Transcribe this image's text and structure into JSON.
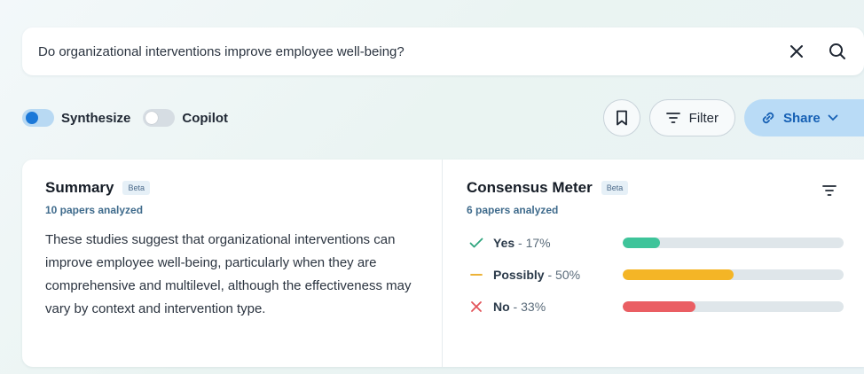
{
  "search": {
    "query": "Do organizational interventions improve employee well-being?",
    "clear_icon": "close-icon",
    "search_icon": "search-icon"
  },
  "controls": {
    "synthesize_label": "Synthesize",
    "synthesize_on": true,
    "copilot_label": "Copilot",
    "copilot_on": false,
    "filter_label": "Filter",
    "share_label": "Share"
  },
  "summary": {
    "title": "Summary",
    "badge": "Beta",
    "papers": "10 papers analyzed",
    "text": "These studies suggest that organizational interventions can improve employee well-being, particularly when they are comprehensive and multilevel, although the effectiveness may vary by context and intervention type."
  },
  "consensus": {
    "title": "Consensus Meter",
    "badge": "Beta",
    "papers": "6 papers analyzed",
    "rows": [
      {
        "label": "Yes",
        "pct_text": "17%",
        "value": 17,
        "color": "#3ec49a",
        "icon": "check-icon",
        "icon_color": "#2fa57e"
      },
      {
        "label": "Possibly",
        "pct_text": "50%",
        "value": 50,
        "color": "#f4b526",
        "icon": "dash-icon",
        "icon_color": "#e9a81b"
      },
      {
        "label": "No",
        "pct_text": "33%",
        "value": 33,
        "color": "#ea5e63",
        "icon": "x-icon",
        "icon_color": "#e2545a"
      }
    ]
  },
  "colors": {
    "accent": "#1b78d8",
    "share_bg": "#b9dbf6"
  }
}
